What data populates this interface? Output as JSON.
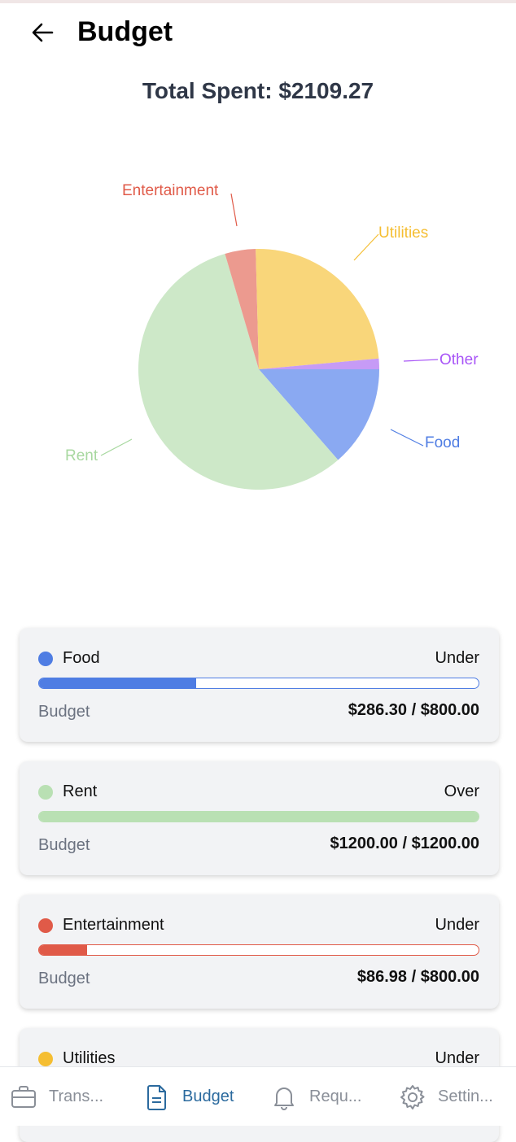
{
  "header": {
    "title": "Budget"
  },
  "summary": {
    "total_spent": "Total Spent: $2109.27"
  },
  "chart_data": {
    "type": "pie",
    "slices": [
      {
        "label": "Food",
        "value": 286.3,
        "color": "#8aa9f2"
      },
      {
        "label": "Rent",
        "value": 1200.0,
        "color": "#cde8c8"
      },
      {
        "label": "Entertainment",
        "value": 86.98,
        "color": "#ec9a8f"
      },
      {
        "label": "Utilities",
        "value": 505.99,
        "color": "#f9d67a"
      },
      {
        "label": "Other",
        "value": 30.0,
        "color": "#c69bf6"
      }
    ],
    "label_colors": {
      "Food": "#4f7de3",
      "Rent": "#a8d8a0",
      "Entertainment": "#e05a48",
      "Utilities": "#f5be32",
      "Other": "#a855f7"
    }
  },
  "budgets": [
    {
      "name": "Food",
      "status": "Under",
      "budget_label": "Budget",
      "amount": "$286.30 / $800.00",
      "progress": 0.358,
      "color": "#4f7de3"
    },
    {
      "name": "Rent",
      "status": "Over",
      "budget_label": "Budget",
      "amount": "$1200.00 / $1200.00",
      "progress": 1.0,
      "color": "#b9e0b3"
    },
    {
      "name": "Entertainment",
      "status": "Under",
      "budget_label": "Budget",
      "amount": "$86.98 / $800.00",
      "progress": 0.109,
      "color": "#e05a48"
    },
    {
      "name": "Utilities",
      "status": "Under",
      "budget_label": "Budget",
      "amount": "",
      "progress": 0.0,
      "color": "#f5be32"
    }
  ],
  "nav": {
    "items": [
      {
        "label": "Trans...",
        "icon": "briefcase-icon",
        "active": false
      },
      {
        "label": "Budget",
        "icon": "document-icon",
        "active": true
      },
      {
        "label": "Requ...",
        "icon": "bell-icon",
        "active": false
      },
      {
        "label": "Settin...",
        "icon": "gear-icon",
        "active": false
      }
    ],
    "active_color": "#2b6a9e",
    "inactive_color": "#8a8f98"
  }
}
